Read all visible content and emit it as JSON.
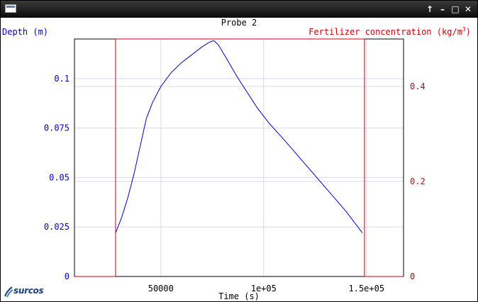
{
  "window": {
    "controls": [
      "↑",
      "–",
      "□",
      "✕"
    ],
    "control_icons": [
      "arrow-up-icon",
      "minimize-icon",
      "maximize-icon",
      "close-icon"
    ]
  },
  "logo": {
    "text": "surcos"
  },
  "chart_data": {
    "type": "line",
    "title": "Probe 2",
    "xlabel": "Time (s)",
    "ylabel_left": "Depth (m)",
    "ylabel_right_main": "Fertilizer concentration (kg/m",
    "ylabel_right_sup": "3",
    "ylabel_right_tail": ")",
    "xlim": [
      8000,
      168000
    ],
    "ylim_left": [
      0,
      0.12
    ],
    "ylim_right": [
      0,
      0.5
    ],
    "x_ticks": [
      50000,
      100000,
      150000
    ],
    "x_tick_labels": [
      "50000",
      "1e+05",
      "1.5e+05"
    ],
    "y_left_ticks": [
      0,
      0.025,
      0.05,
      0.075,
      0.1
    ],
    "y_left_tick_labels": [
      "0",
      "0.025",
      "0.05",
      "0.075",
      "0.1"
    ],
    "y_right_ticks": [
      0,
      0.2,
      0.4
    ],
    "y_right_tick_labels": [
      "0",
      "0.2",
      "0.4"
    ],
    "grid": true,
    "colors": {
      "depth": "#0000cc",
      "concentration": "#cc0000",
      "grid": "#d8d8f0"
    },
    "series": [
      {
        "axis": "left",
        "x": [
          28000,
          31000,
          34000,
          37000,
          40000,
          43000,
          46000,
          50000,
          55000,
          60000,
          65000,
          70000,
          73000,
          75000,
          76000,
          78000,
          82000,
          87000,
          92000,
          97000,
          103000,
          110000,
          120000,
          130000,
          140000,
          148000
        ],
        "y": [
          0.022,
          0.03,
          0.04,
          0.052,
          0.066,
          0.08,
          0.088,
          0.096,
          0.103,
          0.108,
          0.112,
          0.116,
          0.118,
          0.119,
          0.119,
          0.117,
          0.11,
          0.101,
          0.093,
          0.085,
          0.077,
          0.069,
          0.057,
          0.045,
          0.033,
          0.022
        ]
      },
      {
        "axis": "right",
        "x": [
          8000,
          28000,
          28000,
          149000,
          149000,
          168000
        ],
        "y": [
          0,
          0,
          0.5,
          0.5,
          0,
          0
        ]
      }
    ]
  }
}
